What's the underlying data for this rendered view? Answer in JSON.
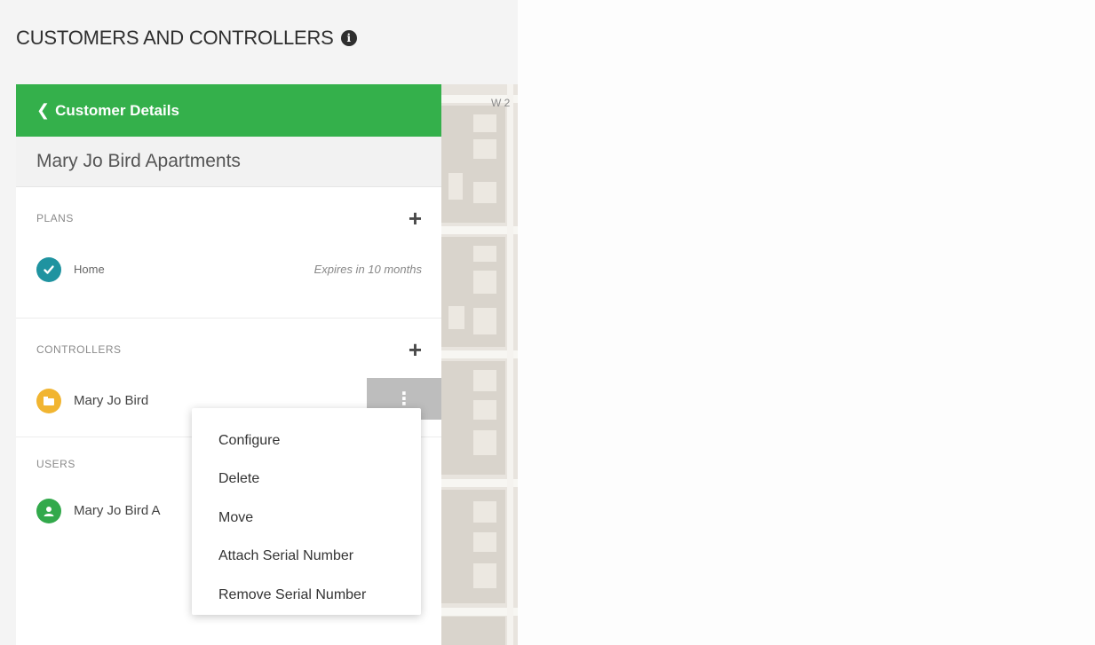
{
  "page": {
    "title": "CUSTOMERS AND CONTROLLERS"
  },
  "map": {
    "top_label": "W 2"
  },
  "panel": {
    "back_label": "Customer Details",
    "customer_name": "Mary Jo Bird Apartments",
    "plans": {
      "label": "PLANS",
      "items": [
        {
          "name": "Home",
          "expires": "Expires in 10 months"
        }
      ]
    },
    "controllers": {
      "label": "CONTROLLERS",
      "items": [
        {
          "name": "Mary Jo Bird"
        }
      ]
    },
    "users": {
      "label": "USERS",
      "items": [
        {
          "name": "Mary Jo Bird A"
        }
      ]
    }
  },
  "menu": {
    "items": [
      "Configure",
      "Delete",
      "Move",
      "Attach Serial Number",
      "Remove Serial Number"
    ]
  },
  "colors": {
    "accent_green": "#34b04b",
    "plan_teal": "#1f93a0",
    "controller_amber": "#f1b531",
    "user_green": "#32a94b"
  },
  "icons": {
    "info": "info-icon",
    "back": "chevron-left-icon",
    "add": "plus-icon",
    "plan": "check-circle-icon",
    "controller": "controller-icon",
    "user": "user-icon",
    "more": "kebab-menu-icon"
  }
}
